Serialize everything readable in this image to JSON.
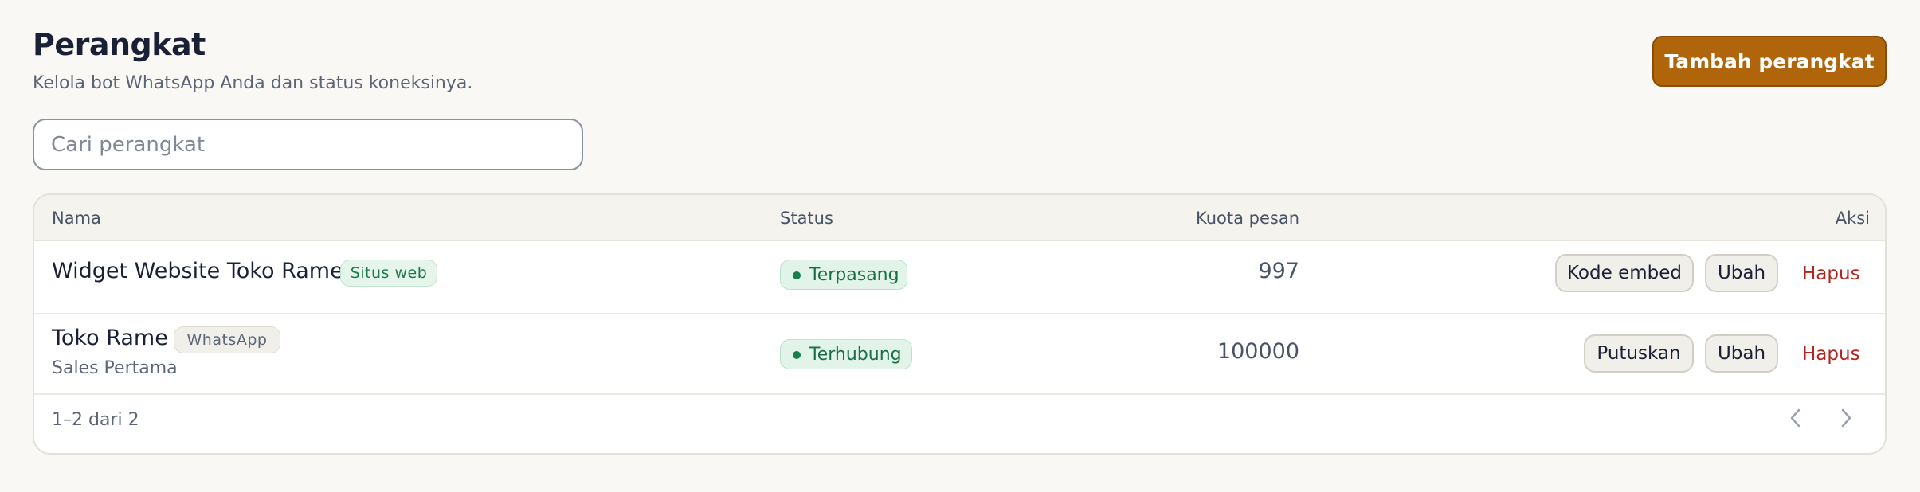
{
  "header": {
    "title": "Perangkat",
    "subtitle": "Kelola bot WhatsApp Anda dan status koneksinya.",
    "add_button": "Tambah perangkat"
  },
  "search": {
    "placeholder": "Cari perangkat",
    "value": ""
  },
  "table": {
    "columns": {
      "name": "Nama",
      "status": "Status",
      "quota": "Kuota pesan",
      "actions": "Aksi"
    },
    "rows": [
      {
        "name": "Widget Website Toko Rame",
        "tag": "Situs web",
        "subtext": "",
        "status": "Terpasang",
        "quota": "997",
        "actions": [
          "Kode embed",
          "Ubah",
          "Hapus"
        ]
      },
      {
        "name": "Toko Rame",
        "tag": "WhatsApp",
        "subtext": "Sales Pertama",
        "status": "Terhubung",
        "quota": "100000",
        "actions": [
          "Putuskan",
          "Ubah",
          "Hapus"
        ]
      }
    ],
    "pagination": {
      "summary": "1–2 dari 2",
      "prev_icon": "chevron-left-icon",
      "next_icon": "chevron-right-icon"
    }
  },
  "colors": {
    "accent": "#b0650a",
    "status_green": "#17804a",
    "danger": "#b3261e",
    "background": "#faf8f4"
  }
}
